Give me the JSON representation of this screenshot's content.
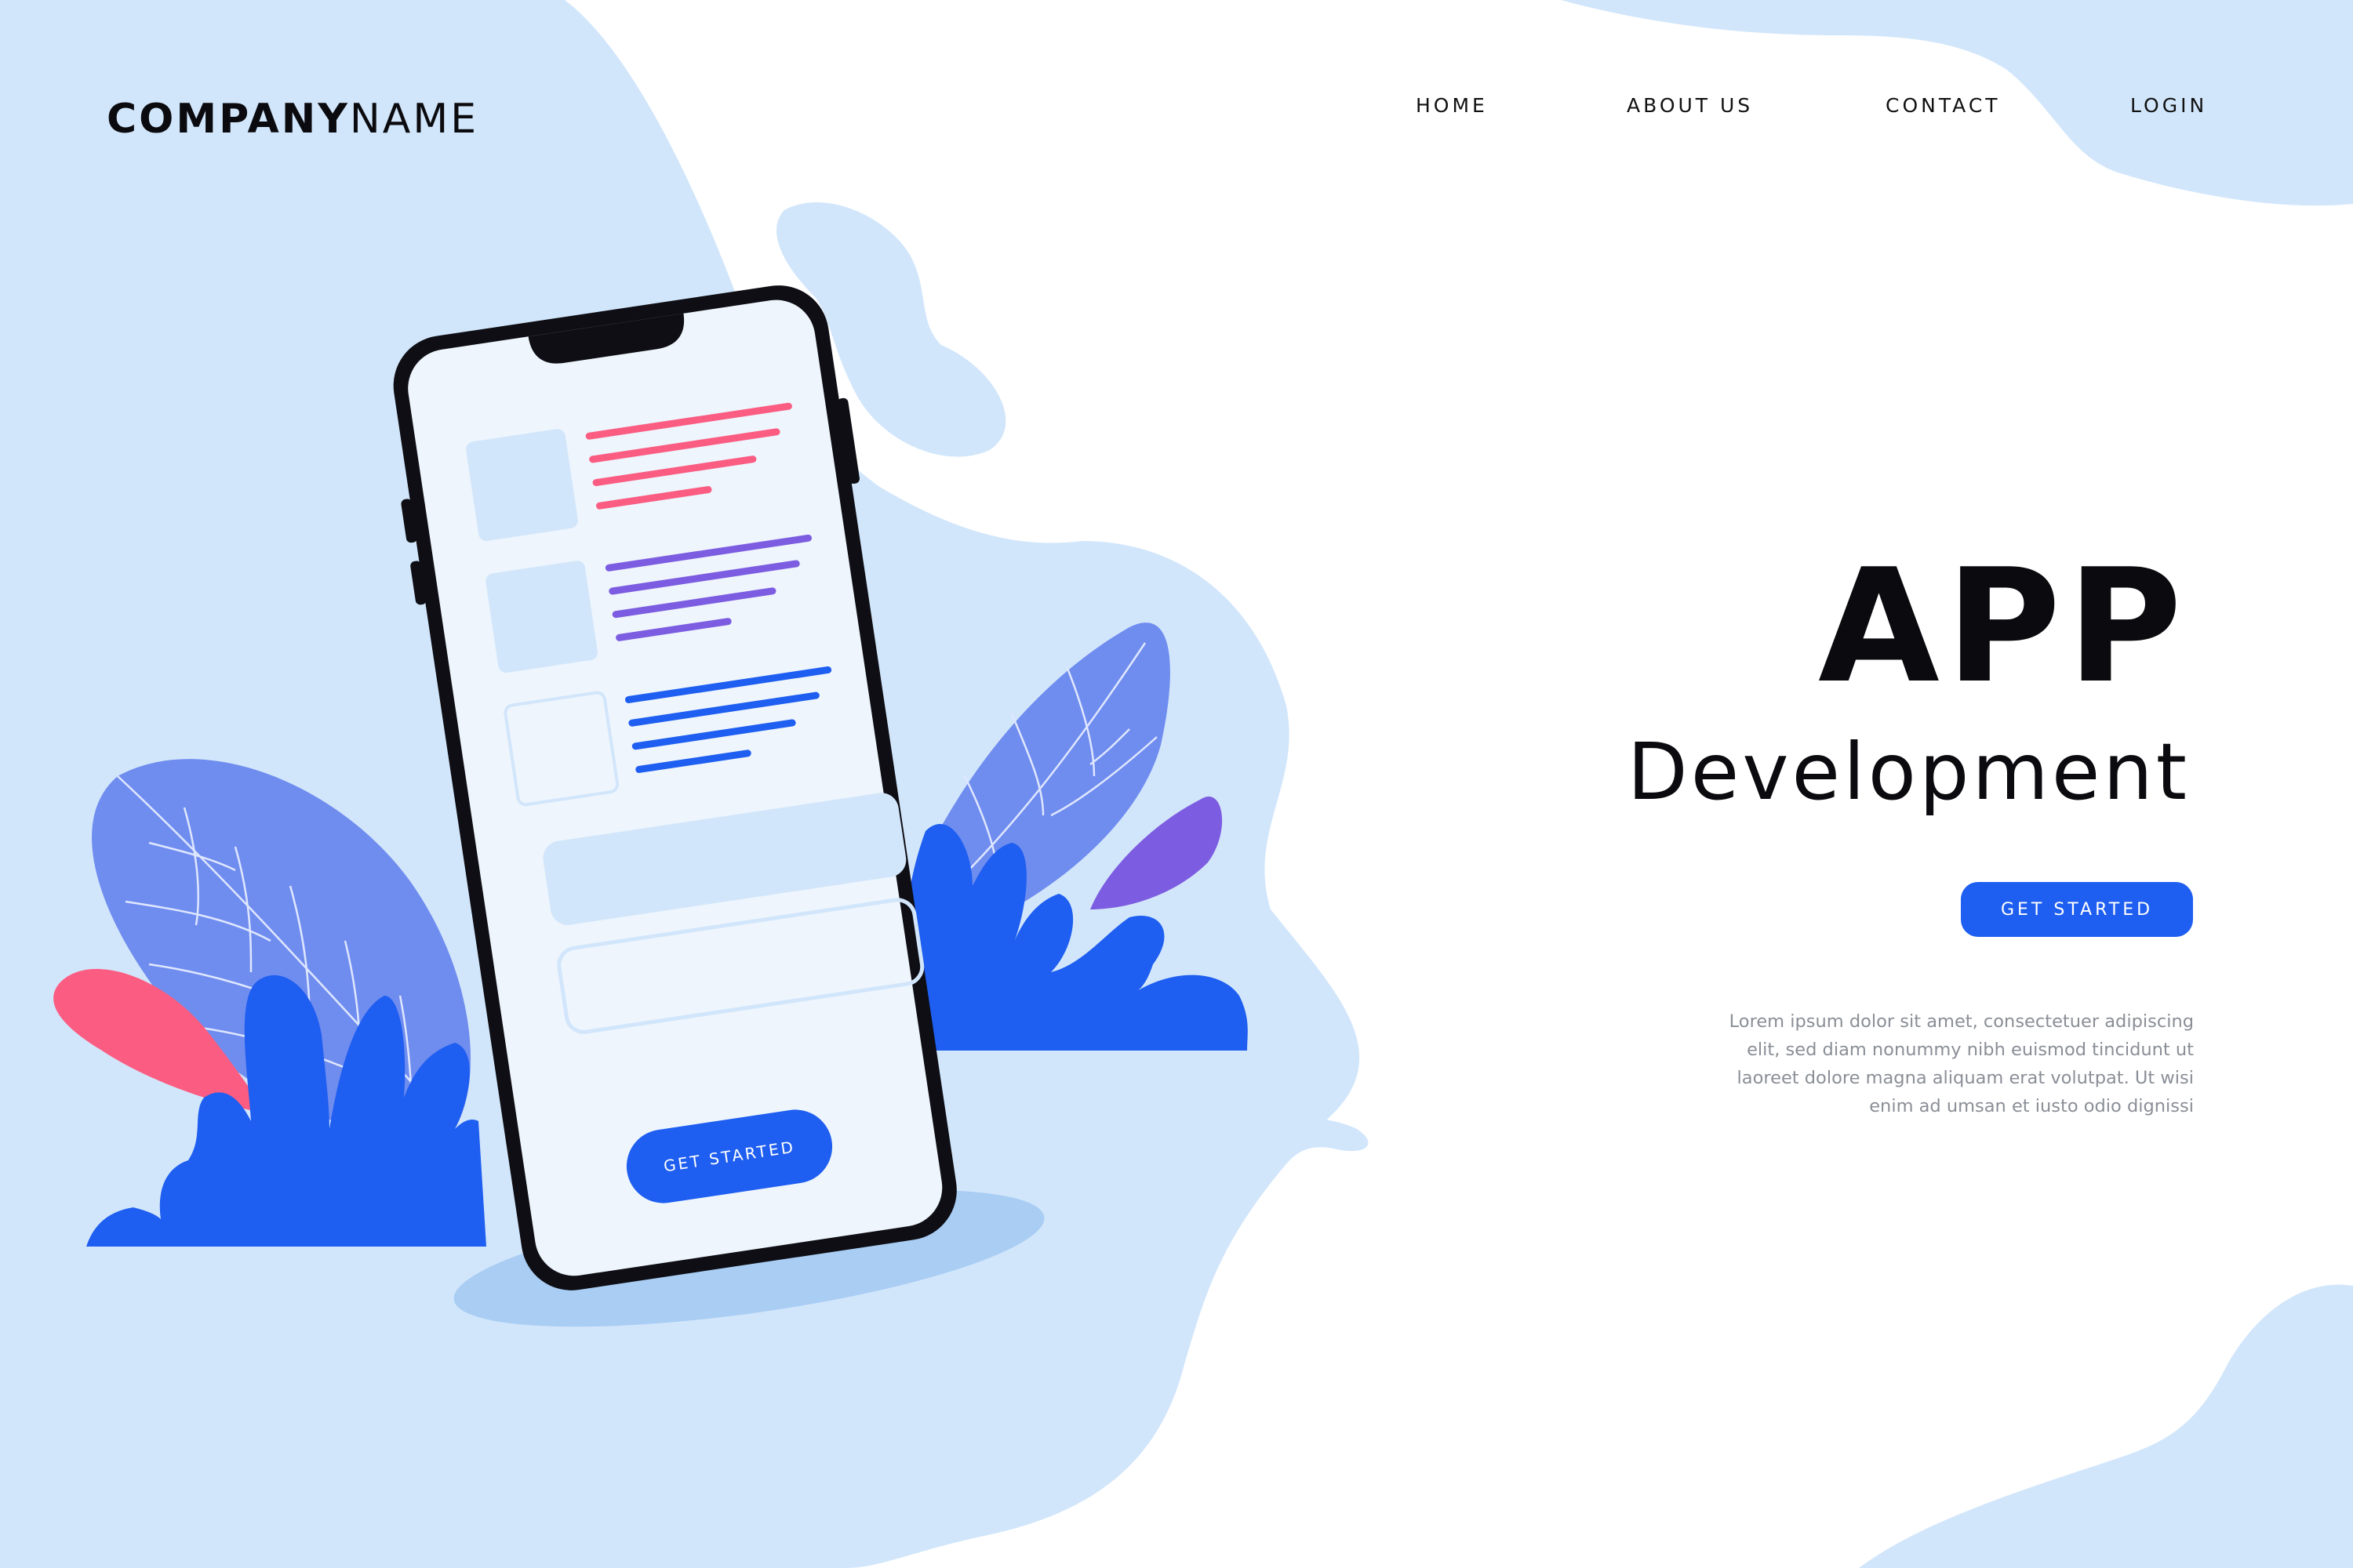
{
  "brand": {
    "logo_bold": "COMPANY",
    "logo_light": "NAME"
  },
  "nav": {
    "items": [
      {
        "label": "HOME"
      },
      {
        "label": "ABOUT US"
      },
      {
        "label": "CONTACT"
      },
      {
        "label": "LOGIN"
      }
    ]
  },
  "hero": {
    "title": "APP",
    "subtitle": "Development",
    "cta_label": "GET STARTED",
    "body_lines": [
      "Lorem ipsum dolor sit amet, consectetuer adipiscing",
      "elit, sed diam nonummy nibh euismod tincidunt ut",
      "laoreet dolore magna aliquam erat volutpat. Ut wisi",
      "enim ad umsan et iusto odio dignissi"
    ]
  },
  "phone": {
    "cta_label": "GET STARTED"
  },
  "colors": {
    "accent": "#1e5ef0",
    "background_blob": "#d2e6fb",
    "leaf": "#6f8cef",
    "pink": "#fb5d82",
    "purple": "#7c5ce0"
  }
}
